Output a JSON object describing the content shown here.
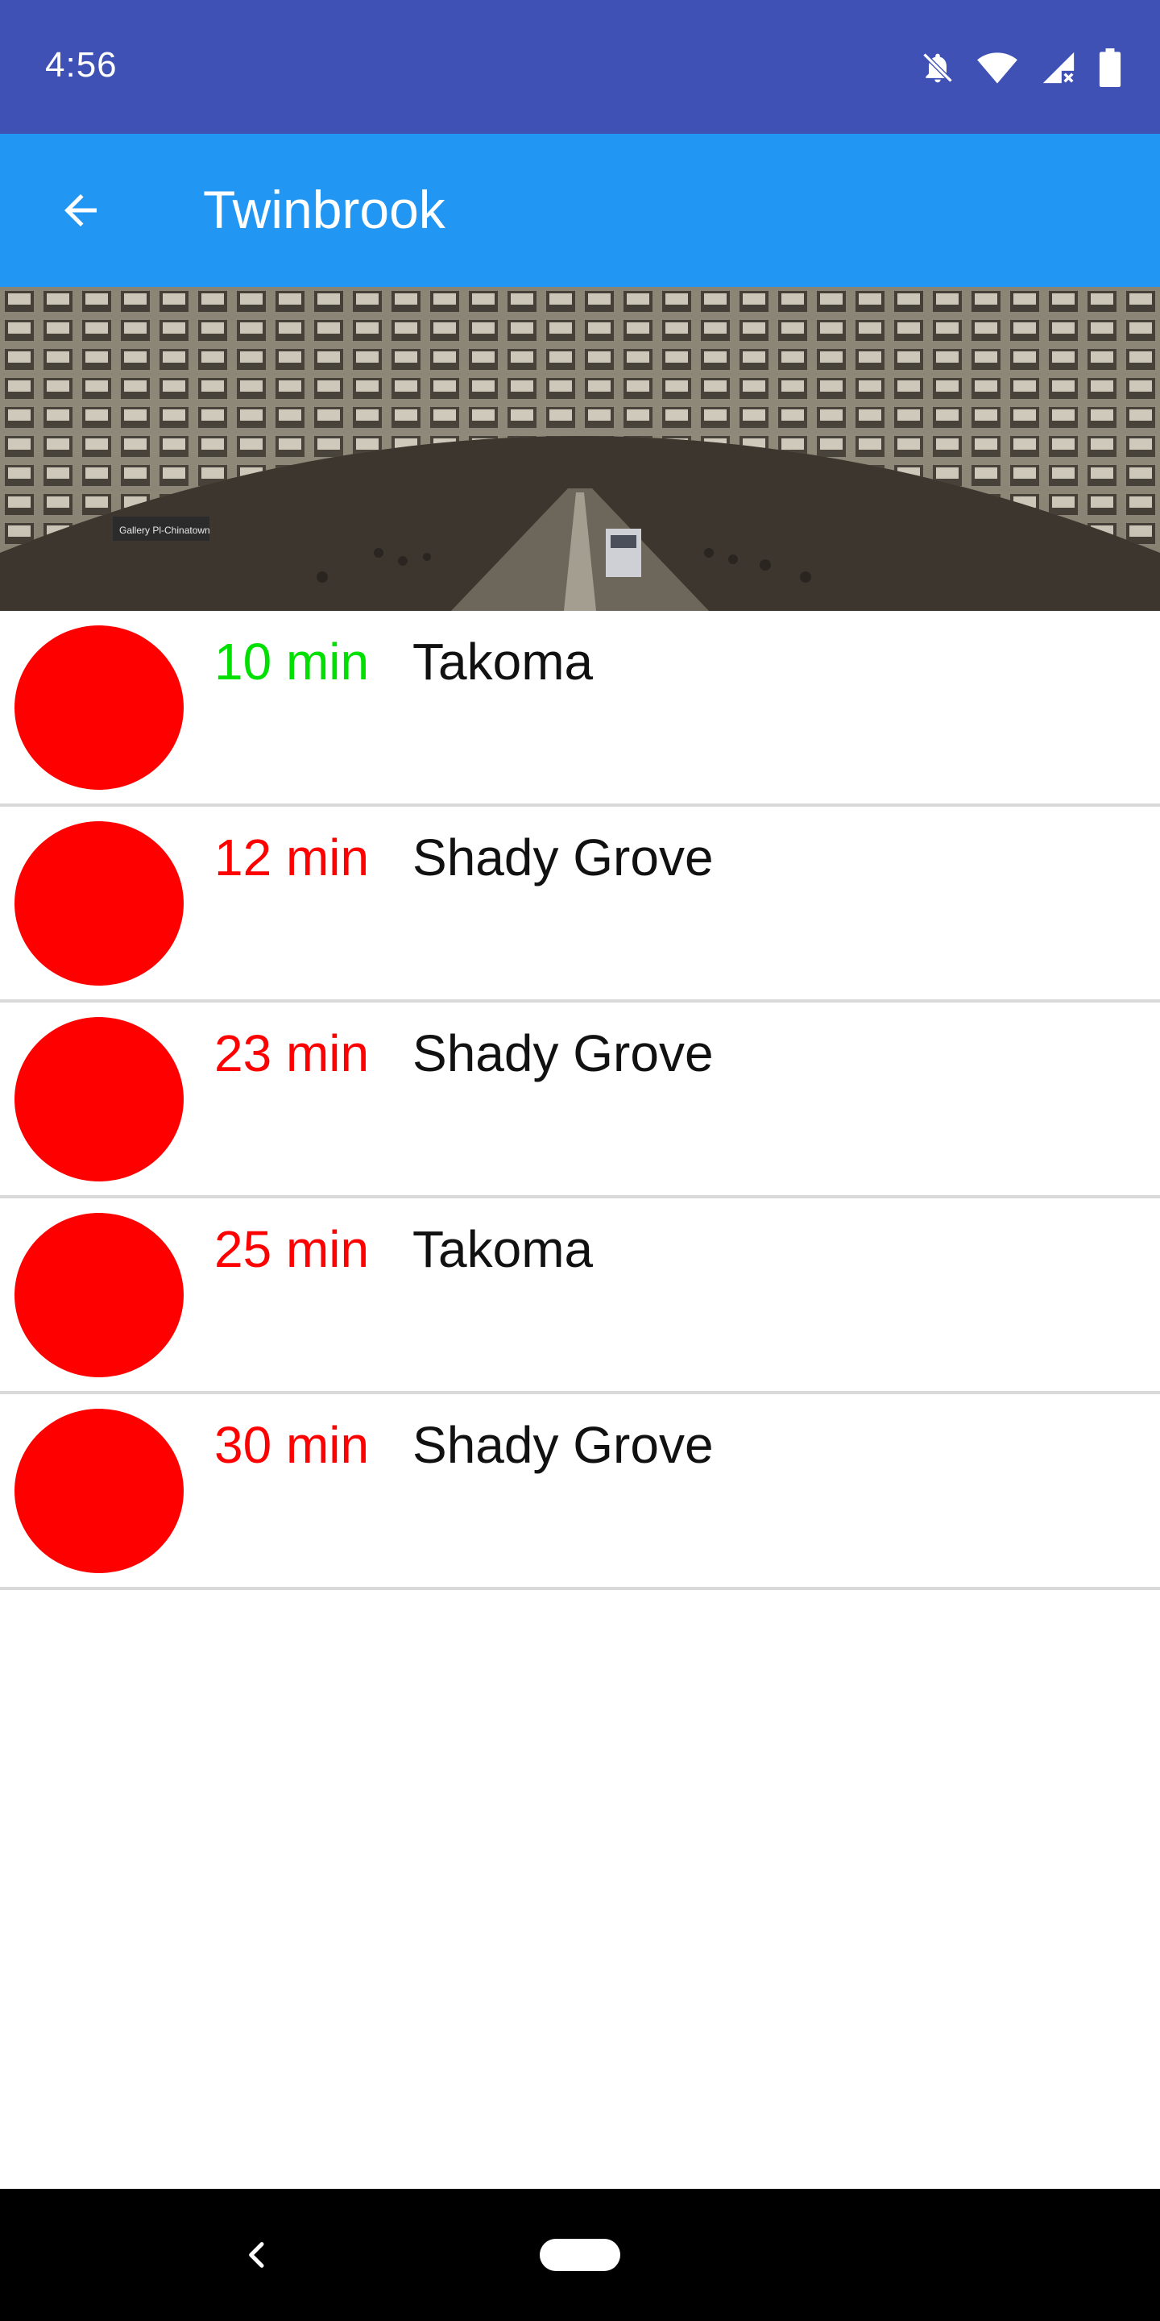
{
  "status_bar": {
    "time": "4:56",
    "icons": [
      "bell-off-icon",
      "wifi-icon",
      "signal-icon",
      "battery-icon"
    ],
    "background": "#3f51b5"
  },
  "app_bar": {
    "title": "Twinbrook",
    "back_icon": "arrow-back-icon",
    "background": "#2196f3"
  },
  "hero": {
    "image": "metro-station-vault-photo",
    "sign_text": "Gallery Pl-Chinatown"
  },
  "arrivals": [
    {
      "eta": "10 min",
      "destination": "Takoma",
      "eta_color": "#00e000",
      "line_color": "#ff0000"
    },
    {
      "eta": "12 min",
      "destination": "Shady Grove",
      "eta_color": "#ff0000",
      "line_color": "#ff0000"
    },
    {
      "eta": "23 min",
      "destination": "Shady Grove",
      "eta_color": "#ff0000",
      "line_color": "#ff0000"
    },
    {
      "eta": "25 min",
      "destination": "Takoma",
      "eta_color": "#ff0000",
      "line_color": "#ff0000"
    },
    {
      "eta": "30 min",
      "destination": "Shady Grove",
      "eta_color": "#ff0000",
      "line_color": "#ff0000"
    }
  ],
  "nav_bar": {
    "back_icon": "chevron-left-icon",
    "home_icon": "home-pill-icon"
  }
}
